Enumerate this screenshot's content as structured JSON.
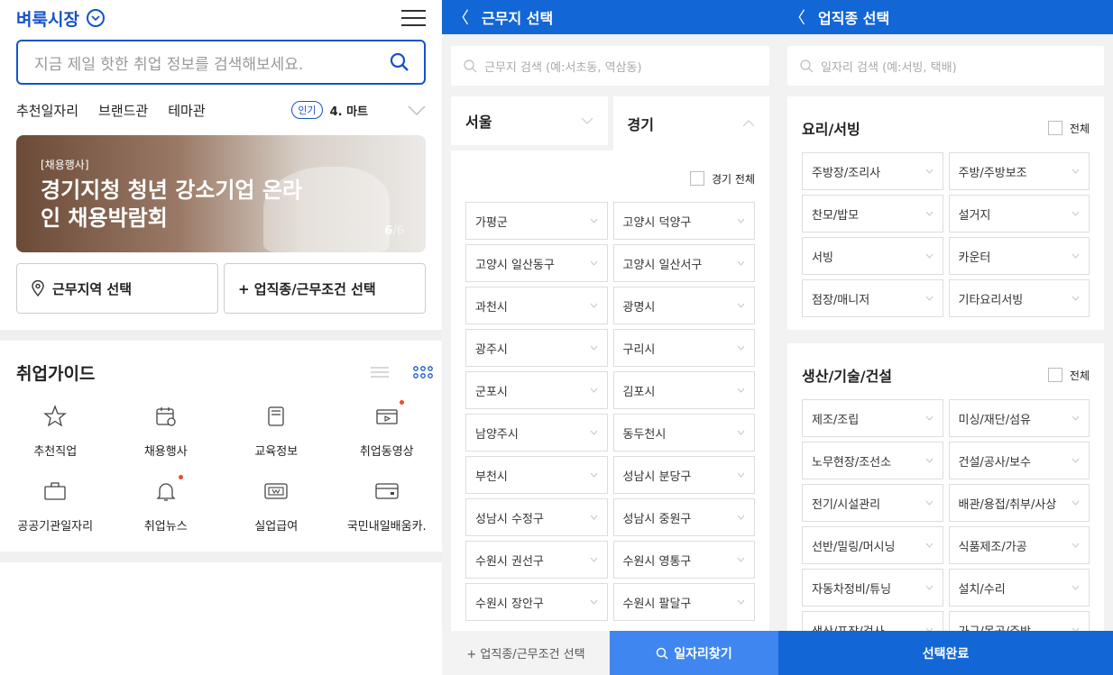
{
  "home": {
    "brand": "벼룩시장",
    "search_placeholder": "지금 제일 핫한 취업 정보를 검색해보세요.",
    "tabs": [
      "추천일자리",
      "브랜드관",
      "테마관"
    ],
    "popular_badge": "인기",
    "popular_text": "4. 마트",
    "banner": {
      "tag": "[채용행사]",
      "title": "경기지청 청년 강소기업 온라인 채용박람회",
      "counter_current": "6",
      "counter_total": "/6"
    },
    "location_button": "근무지역 선택",
    "job_button": "+ 업직종/근무조건 선택",
    "guide_title": "취업가이드",
    "guide_items": [
      {
        "label": "추천직업",
        "icon": "star-icon"
      },
      {
        "label": "채용행사",
        "icon": "calendar-icon"
      },
      {
        "label": "교육정보",
        "icon": "book-icon"
      },
      {
        "label": "취업동영상",
        "icon": "video-icon"
      },
      {
        "label": "공공기관일자리",
        "icon": "briefcase-icon"
      },
      {
        "label": "취업뉴스",
        "icon": "bell-icon"
      },
      {
        "label": "실업급여",
        "icon": "money-icon"
      },
      {
        "label": "국민내일배움카.",
        "icon": "card-icon"
      }
    ]
  },
  "location": {
    "title": "근무지 선택",
    "search_placeholder": "근무지 검색 (예:서초동, 역삼동)",
    "regions": [
      "서울",
      "경기"
    ],
    "check_all_label": "경기 전체",
    "districts": [
      "가평군",
      "고양시 덕양구",
      "고양시 일산동구",
      "고양시 일산서구",
      "과천시",
      "광명시",
      "광주시",
      "구리시",
      "군포시",
      "김포시",
      "남양주시",
      "동두천시",
      "부천시",
      "성남시 분당구",
      "성남시 수정구",
      "성남시 중원구",
      "수원시 권선구",
      "수원시 영통구",
      "수원시 장안구",
      "수원시 팔달구"
    ],
    "bottom_left": "+ 업직종/근무조건 선택",
    "bottom_right": "일자리찾기"
  },
  "jobtype": {
    "title": "업직종 선택",
    "search_placeholder": "일자리 검색 (예:서빙, 택배)",
    "all_label": "전체",
    "sections": [
      {
        "title": "요리/서빙",
        "items": [
          "주방장/조리사",
          "주방/주방보조",
          "찬모/밥모",
          "설거지",
          "서빙",
          "카운터",
          "점장/매니저",
          "기타요리서빙"
        ]
      },
      {
        "title": "생산/기술/건설",
        "items": [
          "제조/조립",
          "미싱/재단/섬유",
          "노무현장/조선소",
          "건설/공사/보수",
          "전기/시설관리",
          "배관/용접/취부/사상",
          "선반/밀링/머시닝",
          "식품제조/가공",
          "자동차정비/튜닝",
          "설치/수리",
          "생산/포장/검사",
          "가구/목공/주방"
        ]
      }
    ],
    "complete_button": "선택완료"
  }
}
